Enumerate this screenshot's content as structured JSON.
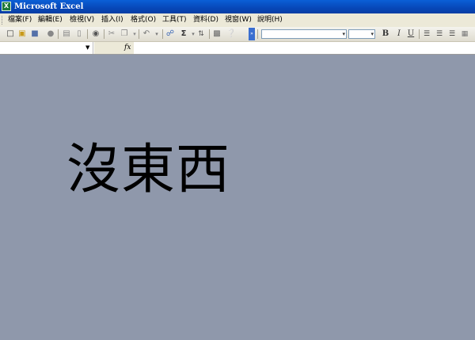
{
  "window": {
    "title": "Microsoft Excel"
  },
  "menu": {
    "items": [
      "檔案(F)",
      "編輯(E)",
      "檢視(V)",
      "插入(I)",
      "格式(O)",
      "工具(T)",
      "資料(D)",
      "視窗(W)",
      "說明(H)"
    ]
  },
  "toolbar": {
    "icons": [
      "new-icon",
      "open-icon",
      "save-icon",
      "permission-icon",
      "print-icon",
      "print-preview-icon",
      "research-icon",
      "cut-icon",
      "copy-icon",
      "paste-icon",
      "undo-icon",
      "redo-icon",
      "hyperlink-icon",
      "autosum-icon",
      "sort-icon",
      "chart-icon",
      "help-icon"
    ],
    "font_name_value": "",
    "font_size_value": "",
    "bold_label": "B",
    "italic_label": "I",
    "underline_label": "U"
  },
  "formula_bar": {
    "name_box_value": "",
    "fx_label": "fx",
    "formula_value": ""
  },
  "workspace": {
    "message": "沒東西",
    "background": "#8f98ab"
  }
}
